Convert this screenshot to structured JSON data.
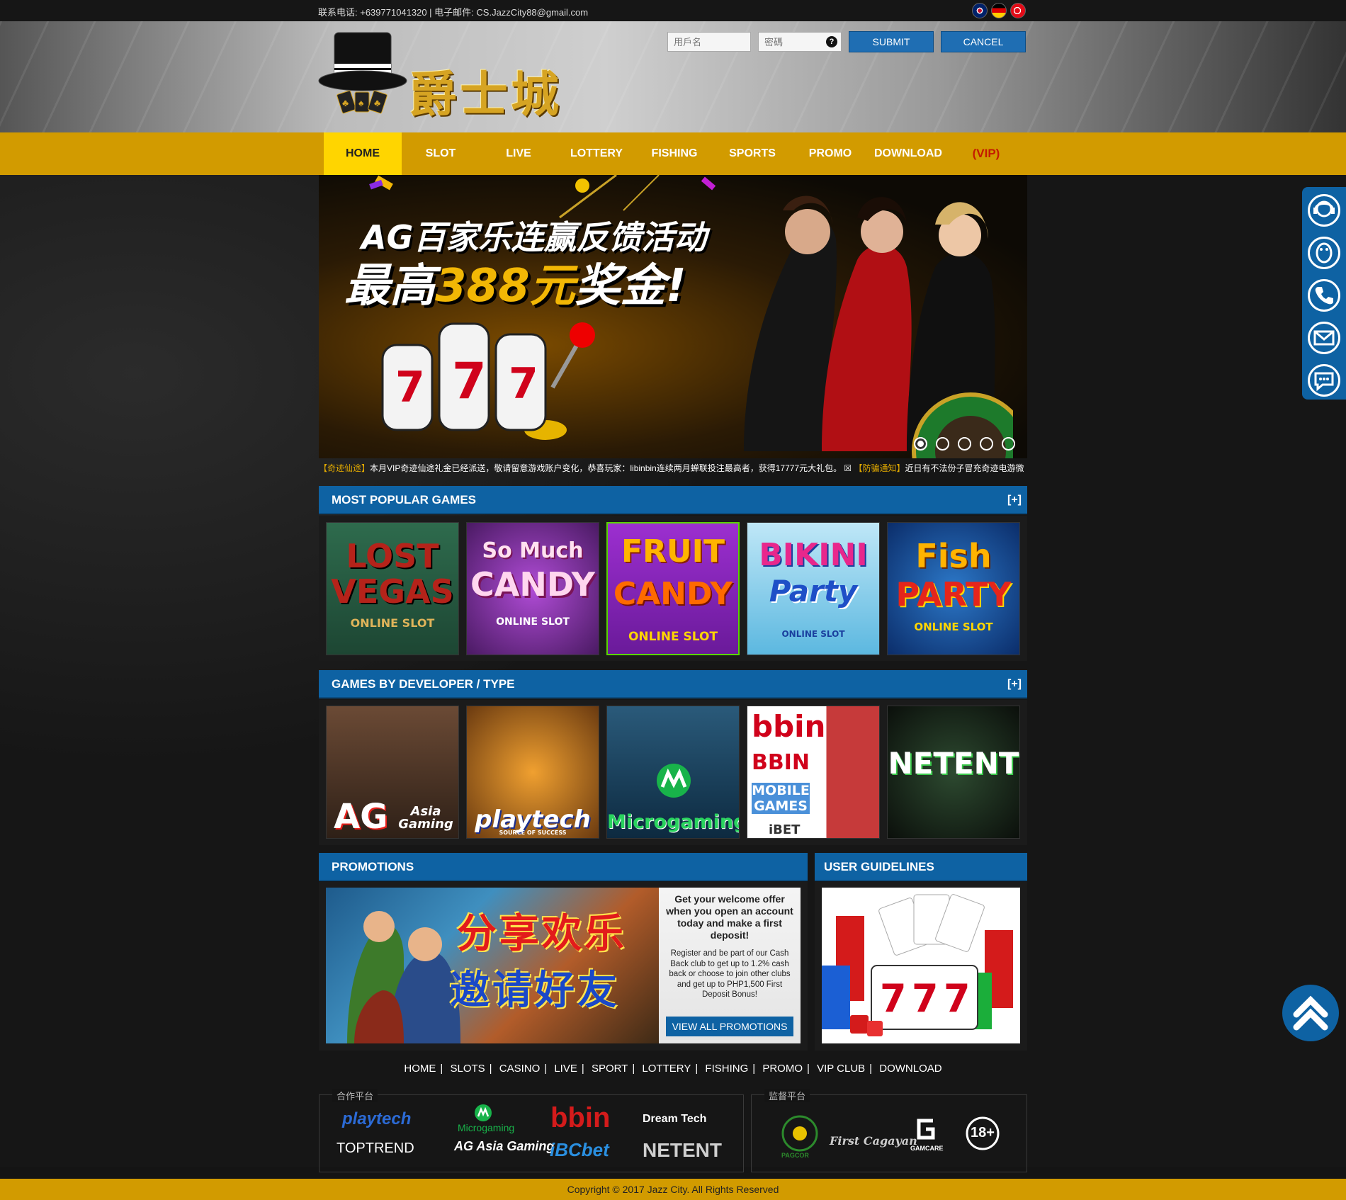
{
  "topbar": {
    "contact": "联系电话: +639771041320  |  电子邮件: CS.JazzCity88@gmail.com"
  },
  "header": {
    "logo_text": "爵士城",
    "username_placeholder": "用戶名",
    "password_placeholder": "密碼",
    "help_glyph": "?",
    "submit_label": "SUBMIT",
    "cancel_label": "CANCEL"
  },
  "nav": {
    "items": [
      "HOME",
      "SLOT",
      "LIVE",
      "LOTTERY",
      "FISHING",
      "SPORTS",
      "PROMO",
      "DOWNLOAD"
    ],
    "vip": "(VIP)"
  },
  "banner": {
    "title_line1": "AG百家乐连赢反馈活动",
    "title_line2_a": "最高",
    "title_line2_b": "388元",
    "title_line2_c": "奖金!",
    "slide_count": 5,
    "active_slide": 1
  },
  "marquee": {
    "tag1": "【奇迹仙途】",
    "text1": "本月VIP奇迹仙途礼金已经派送，敬请留意游戏账户变化，恭喜玩家：libinbin连续两月蝉联投注最高者，获得17777元大礼包。",
    "sep": " ☒ ",
    "tag2": "【防骗通知】",
    "text2": "近日有不法份子冒充奇迹电游微"
  },
  "sections": {
    "popular": "MOST POPULAR GAMES",
    "developer": "GAMES BY DEVELOPER / TYPE",
    "promotions": "PROMOTIONS",
    "guidelines": "USER GUIDELINES",
    "expand": "[+]"
  },
  "popular_games": [
    {
      "line1": "LOST",
      "line2": "VEGAS",
      "sub": "ONLINE SLOT"
    },
    {
      "line1": "So Much",
      "line2": "CANDY",
      "sub": "ONLINE SLOT"
    },
    {
      "line1": "FRUIT",
      "line2": "CANDY",
      "sub": "ONLINE SLOT"
    },
    {
      "line1": "BIKINI",
      "line2": "Party",
      "sub": "ONLINE SLOT"
    },
    {
      "line1": "Fish",
      "line2": "PARTY",
      "sub": "ONLINE SLOT"
    }
  ],
  "developers": [
    {
      "name": "AG",
      "sub": "Asia Gaming"
    },
    {
      "name": "playtech",
      "sub": "SOURCE OF SUCCESS"
    },
    {
      "name": "Microgaming",
      "sub": ""
    },
    {
      "name": "bbin",
      "sub": "BBIN",
      "extra": "MOBILE GAMES",
      "extra2": "iBET"
    },
    {
      "name": "NETENT",
      "sub": ""
    }
  ],
  "promo": {
    "cn_line1": "分享欢乐",
    "cn_line2": "邀请好友",
    "heading": "Get your welcome offer when you open an account today and make a first deposit!",
    "body": "Register and be part of our Cash Back club to get up to 1.2% cash back or choose to join other clubs and get up to PHP1,500 First Deposit Bonus!",
    "button": "VIEW ALL PROMOTIONS"
  },
  "footer": {
    "links": [
      "HOME",
      "SLOTS",
      "CASINO",
      "LIVE",
      "SPORT",
      "LOTTERY",
      "FISHING",
      "PROMO",
      "VIP CLUB",
      "DOWNLOAD"
    ],
    "separator": "|",
    "partners_title": "合作平台",
    "regulators_title": "监督平台",
    "partners": [
      "playtech",
      "Microgaming",
      "bbin",
      "Dream Tech",
      "TOPTREND",
      "AG Asia Gaming",
      "iBCbet",
      "NETENT"
    ],
    "regulators": [
      "PAGCOR",
      "First Cagayan",
      "GAMCARE",
      "18+"
    ],
    "copyright": "Copyright © 2017  Jazz City. All Rights Reserved"
  },
  "colors": {
    "nav_gold": "#d29b00",
    "nav_active": "#ffd500",
    "section_blue": "#0e62a3",
    "vip_red": "#c41a00"
  }
}
